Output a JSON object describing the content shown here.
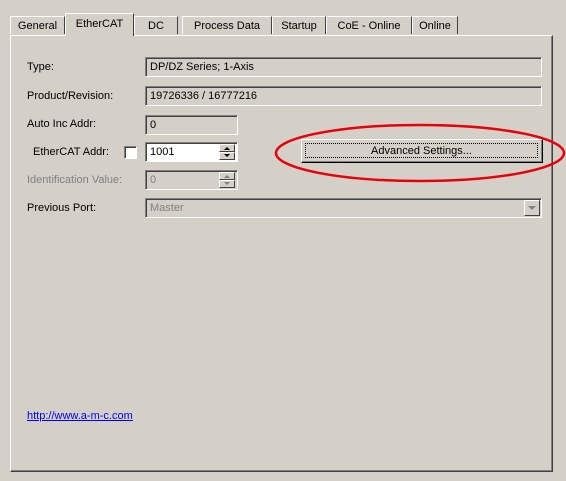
{
  "tabs": [
    {
      "label": "General"
    },
    {
      "label": "EtherCAT"
    },
    {
      "label": "DC"
    },
    {
      "label": "Process Data"
    },
    {
      "label": "Startup"
    },
    {
      "label": "CoE - Online"
    },
    {
      "label": "Online"
    }
  ],
  "active_tab": "EtherCAT",
  "fields": {
    "type": {
      "label": "Type:",
      "value": "DP/DZ Series; 1-Axis"
    },
    "product_revision": {
      "label": "Product/Revision:",
      "value": "19726336 / 16777216"
    },
    "auto_inc_addr": {
      "label": "Auto Inc Addr:",
      "value": "0"
    },
    "ethercat_addr": {
      "label": "EtherCAT Addr:",
      "value": "1001",
      "checked": false
    },
    "identification_value": {
      "label": "Identification Value:",
      "value": "0",
      "disabled": true
    },
    "previous_port": {
      "label": "Previous Port:",
      "value": "Master",
      "disabled": true
    }
  },
  "advanced_settings_button": {
    "label": "Advanced Settings..."
  },
  "link": {
    "text": "http://www.a-m-c.com"
  },
  "annotation_color": "#e8000b"
}
